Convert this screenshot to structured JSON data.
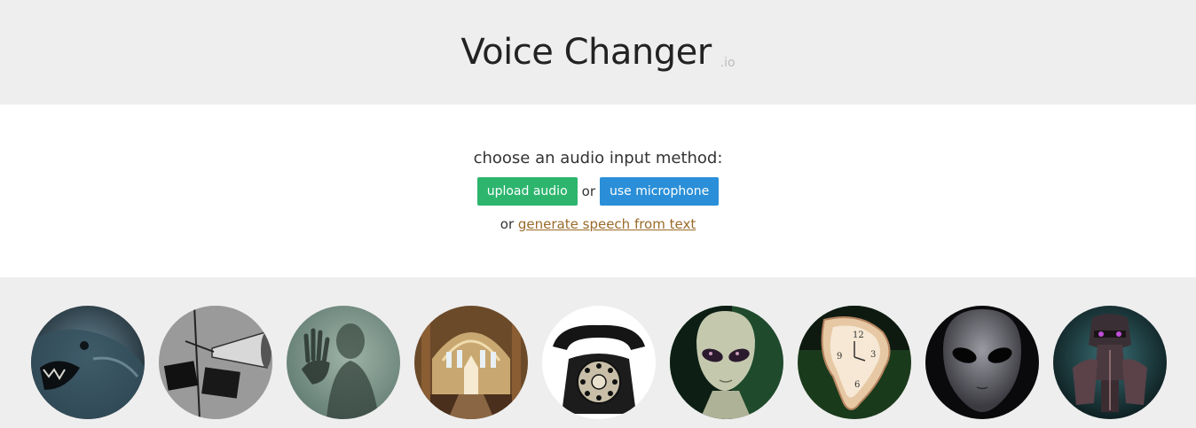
{
  "header": {
    "title": "Voice Changer",
    "suffix": ".io"
  },
  "input": {
    "prompt": "choose an audio input method:",
    "upload_label": "upload audio",
    "or_label": "or",
    "mic_label": "use microphone",
    "text_prefix": "or",
    "text_link": "generate speech from text"
  },
  "colors": {
    "upload_button": "#2db56e",
    "mic_button": "#2a8fd8",
    "link": "#9a6a2a",
    "header_bg": "#eeeeee"
  },
  "voices": [
    {
      "name": "creature-mouth-icon"
    },
    {
      "name": "megaphone-icon"
    },
    {
      "name": "ghost-hand-icon"
    },
    {
      "name": "cathedral-icon"
    },
    {
      "name": "telephone-icon"
    },
    {
      "name": "alien-icon"
    },
    {
      "name": "melting-clock-icon"
    },
    {
      "name": "grey-alien-icon"
    },
    {
      "name": "robot-icon"
    }
  ]
}
